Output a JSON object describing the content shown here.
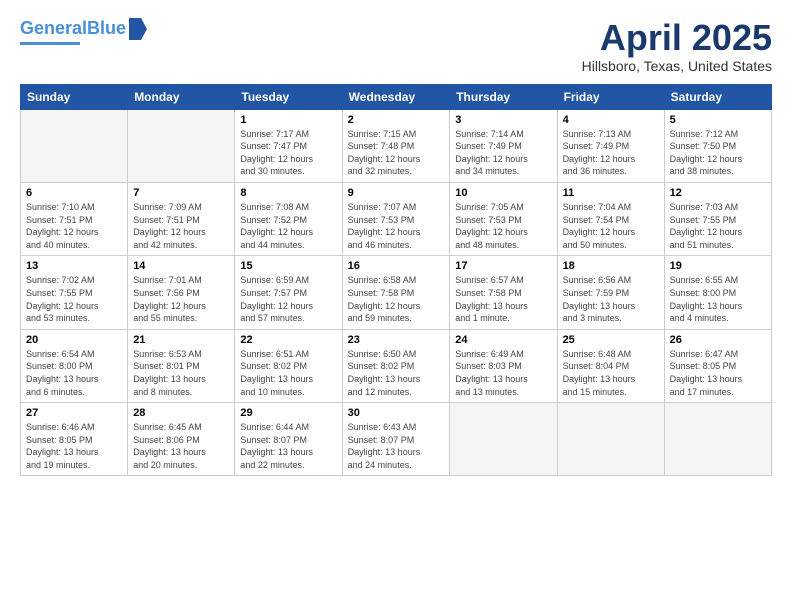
{
  "header": {
    "logo_line1": "General",
    "logo_line2": "Blue",
    "main_title": "April 2025",
    "subtitle": "Hillsboro, Texas, United States"
  },
  "calendar": {
    "days_of_week": [
      "Sunday",
      "Monday",
      "Tuesday",
      "Wednesday",
      "Thursday",
      "Friday",
      "Saturday"
    ],
    "weeks": [
      [
        {
          "day": "",
          "info": ""
        },
        {
          "day": "",
          "info": ""
        },
        {
          "day": "1",
          "info": "Sunrise: 7:17 AM\nSunset: 7:47 PM\nDaylight: 12 hours\nand 30 minutes."
        },
        {
          "day": "2",
          "info": "Sunrise: 7:15 AM\nSunset: 7:48 PM\nDaylight: 12 hours\nand 32 minutes."
        },
        {
          "day": "3",
          "info": "Sunrise: 7:14 AM\nSunset: 7:49 PM\nDaylight: 12 hours\nand 34 minutes."
        },
        {
          "day": "4",
          "info": "Sunrise: 7:13 AM\nSunset: 7:49 PM\nDaylight: 12 hours\nand 36 minutes."
        },
        {
          "day": "5",
          "info": "Sunrise: 7:12 AM\nSunset: 7:50 PM\nDaylight: 12 hours\nand 38 minutes."
        }
      ],
      [
        {
          "day": "6",
          "info": "Sunrise: 7:10 AM\nSunset: 7:51 PM\nDaylight: 12 hours\nand 40 minutes."
        },
        {
          "day": "7",
          "info": "Sunrise: 7:09 AM\nSunset: 7:51 PM\nDaylight: 12 hours\nand 42 minutes."
        },
        {
          "day": "8",
          "info": "Sunrise: 7:08 AM\nSunset: 7:52 PM\nDaylight: 12 hours\nand 44 minutes."
        },
        {
          "day": "9",
          "info": "Sunrise: 7:07 AM\nSunset: 7:53 PM\nDaylight: 12 hours\nand 46 minutes."
        },
        {
          "day": "10",
          "info": "Sunrise: 7:05 AM\nSunset: 7:53 PM\nDaylight: 12 hours\nand 48 minutes."
        },
        {
          "day": "11",
          "info": "Sunrise: 7:04 AM\nSunset: 7:54 PM\nDaylight: 12 hours\nand 50 minutes."
        },
        {
          "day": "12",
          "info": "Sunrise: 7:03 AM\nSunset: 7:55 PM\nDaylight: 12 hours\nand 51 minutes."
        }
      ],
      [
        {
          "day": "13",
          "info": "Sunrise: 7:02 AM\nSunset: 7:55 PM\nDaylight: 12 hours\nand 53 minutes."
        },
        {
          "day": "14",
          "info": "Sunrise: 7:01 AM\nSunset: 7:56 PM\nDaylight: 12 hours\nand 55 minutes."
        },
        {
          "day": "15",
          "info": "Sunrise: 6:59 AM\nSunset: 7:57 PM\nDaylight: 12 hours\nand 57 minutes."
        },
        {
          "day": "16",
          "info": "Sunrise: 6:58 AM\nSunset: 7:58 PM\nDaylight: 12 hours\nand 59 minutes."
        },
        {
          "day": "17",
          "info": "Sunrise: 6:57 AM\nSunset: 7:58 PM\nDaylight: 13 hours\nand 1 minute."
        },
        {
          "day": "18",
          "info": "Sunrise: 6:56 AM\nSunset: 7:59 PM\nDaylight: 13 hours\nand 3 minutes."
        },
        {
          "day": "19",
          "info": "Sunrise: 6:55 AM\nSunset: 8:00 PM\nDaylight: 13 hours\nand 4 minutes."
        }
      ],
      [
        {
          "day": "20",
          "info": "Sunrise: 6:54 AM\nSunset: 8:00 PM\nDaylight: 13 hours\nand 6 minutes."
        },
        {
          "day": "21",
          "info": "Sunrise: 6:53 AM\nSunset: 8:01 PM\nDaylight: 13 hours\nand 8 minutes."
        },
        {
          "day": "22",
          "info": "Sunrise: 6:51 AM\nSunset: 8:02 PM\nDaylight: 13 hours\nand 10 minutes."
        },
        {
          "day": "23",
          "info": "Sunrise: 6:50 AM\nSunset: 8:02 PM\nDaylight: 13 hours\nand 12 minutes."
        },
        {
          "day": "24",
          "info": "Sunrise: 6:49 AM\nSunset: 8:03 PM\nDaylight: 13 hours\nand 13 minutes."
        },
        {
          "day": "25",
          "info": "Sunrise: 6:48 AM\nSunset: 8:04 PM\nDaylight: 13 hours\nand 15 minutes."
        },
        {
          "day": "26",
          "info": "Sunrise: 6:47 AM\nSunset: 8:05 PM\nDaylight: 13 hours\nand 17 minutes."
        }
      ],
      [
        {
          "day": "27",
          "info": "Sunrise: 6:46 AM\nSunset: 8:05 PM\nDaylight: 13 hours\nand 19 minutes."
        },
        {
          "day": "28",
          "info": "Sunrise: 6:45 AM\nSunset: 8:06 PM\nDaylight: 13 hours\nand 20 minutes."
        },
        {
          "day": "29",
          "info": "Sunrise: 6:44 AM\nSunset: 8:07 PM\nDaylight: 13 hours\nand 22 minutes."
        },
        {
          "day": "30",
          "info": "Sunrise: 6:43 AM\nSunset: 8:07 PM\nDaylight: 13 hours\nand 24 minutes."
        },
        {
          "day": "",
          "info": ""
        },
        {
          "day": "",
          "info": ""
        },
        {
          "day": "",
          "info": ""
        }
      ]
    ]
  }
}
